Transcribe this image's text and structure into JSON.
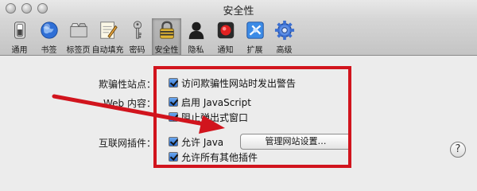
{
  "window": {
    "title": "安全性"
  },
  "toolbar": {
    "items": [
      {
        "label": "通用",
        "icon": "general-switch-icon"
      },
      {
        "label": "书签",
        "icon": "globe-icon"
      },
      {
        "label": "标签页",
        "icon": "tabs-icon"
      },
      {
        "label": "自动填充",
        "icon": "autofill-pencil-icon"
      },
      {
        "label": "密码",
        "icon": "key-icon"
      },
      {
        "label": "安全性",
        "icon": "padlock-icon",
        "selected": true
      },
      {
        "label": "隐私",
        "icon": "person-silhouette-icon"
      },
      {
        "label": "通知",
        "icon": "record-notification-icon"
      },
      {
        "label": "扩展",
        "icon": "puzzle-extension-icon"
      },
      {
        "label": "高级",
        "icon": "gear-icon"
      }
    ]
  },
  "settings": {
    "fraud": {
      "label": "欺骗性站点：",
      "option": "访问欺骗性网站时发出警告",
      "checked": true
    },
    "web_content": {
      "label": "Web 内容：",
      "options": [
        {
          "text": "启用 JavaScript",
          "checked": true
        },
        {
          "text": "阻止弹出式窗口",
          "checked": true
        }
      ]
    },
    "plugins": {
      "label": "互联网插件：",
      "allow_java": {
        "text": "允许 Java",
        "checked": true
      },
      "manage_button": "管理网站设置…",
      "allow_all": {
        "text": "允许所有其他插件",
        "checked": true
      }
    }
  },
  "help": {
    "label": "?"
  },
  "annotation": {
    "color": "#d1141d"
  }
}
